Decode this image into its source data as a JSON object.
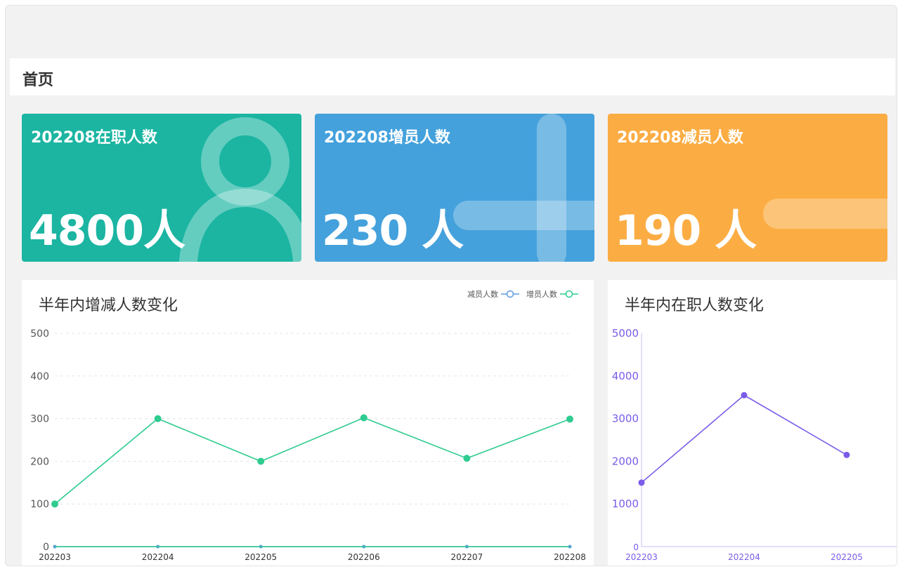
{
  "page": {
    "title": "首页"
  },
  "cards": [
    {
      "title": "202208在职人数",
      "value": "4800人",
      "color": "#1bb5a2",
      "icon": "person-icon"
    },
    {
      "title": "202208增员人数",
      "value": "230 人",
      "color": "#44a1dc",
      "icon": "plus-icon"
    },
    {
      "title": "202208减员人数",
      "value": "190 人",
      "color": "#fbad44",
      "icon": "minus-icon"
    }
  ],
  "chart_data": [
    {
      "type": "line",
      "title": "半年内增减人数变化",
      "categories": [
        "202203",
        "202204",
        "202205",
        "202206",
        "202207",
        "202208"
      ],
      "ylim": [
        0,
        500
      ],
      "yticks": [
        0,
        100,
        200,
        300,
        400,
        500
      ],
      "grid": true,
      "legend_position": "top-right",
      "series": [
        {
          "name": "减员人数",
          "color": "#5b9bdc",
          "values": [
            0,
            0,
            0,
            0,
            0,
            0
          ]
        },
        {
          "name": "增员人数",
          "color": "#2ecc8f",
          "values": [
            100,
            300,
            200,
            302,
            207,
            299
          ]
        }
      ]
    },
    {
      "type": "line",
      "title": "半年内在职人数变化",
      "categories": [
        "202203",
        "202204",
        "202205"
      ],
      "ylim": [
        0,
        5000
      ],
      "yticks": [
        0,
        1000,
        2000,
        3000,
        4000,
        5000
      ],
      "grid": false,
      "color": "#7b5ce8",
      "series": [
        {
          "values": [
            1500,
            3550,
            2150
          ]
        }
      ]
    }
  ]
}
